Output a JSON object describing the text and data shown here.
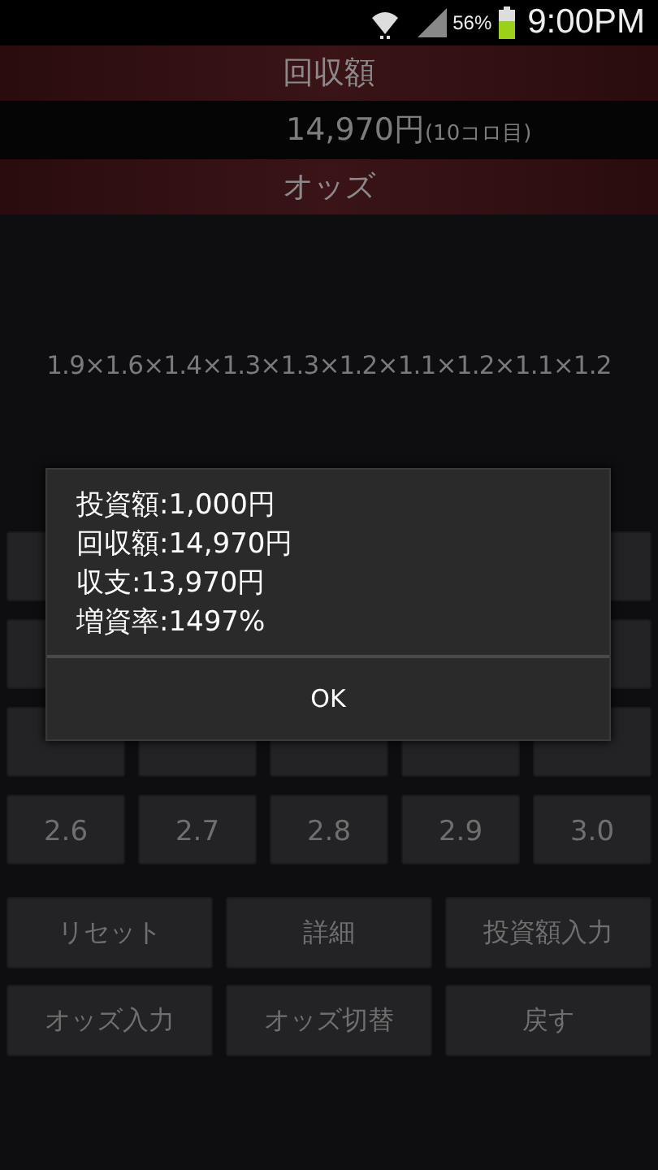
{
  "status_bar": {
    "battery_percent": "56%",
    "time": "9:00PM"
  },
  "sections": [
    {
      "kind": "header",
      "text": "回収額"
    },
    {
      "kind": "value",
      "amount": "14,970円",
      "note": "(10コロ目)"
    },
    {
      "kind": "header",
      "text": "オッズ"
    }
  ],
  "odds_sequence": "1.9×1.6×1.4×1.3×1.3×1.2×1.1×1.2×1.1×1.2",
  "odds_buttons": [
    "2.6",
    "2.7",
    "2.8",
    "2.9",
    "3.0"
  ],
  "action_buttons": [
    "リセット",
    "詳細",
    "投資額入力",
    "オッズ入力",
    "オッズ切替",
    "戻す"
  ],
  "dialog": {
    "lines": [
      "投資額:1,000円",
      "回収額:14,970円",
      "収支:13,970円",
      "増資率:1497%"
    ],
    "button": "OK"
  }
}
